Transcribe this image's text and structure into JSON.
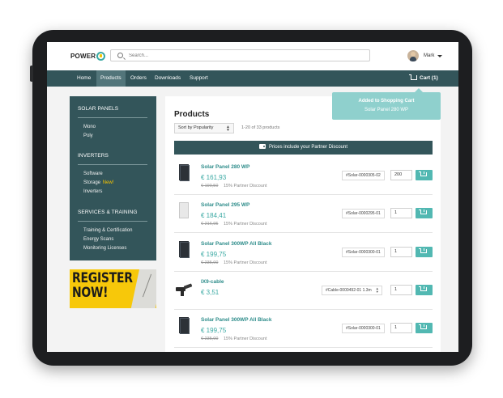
{
  "brand": {
    "logo_text": "POWER",
    "accent": "#3aa9a3",
    "nav_color": "#33555a"
  },
  "search": {
    "placeholder": "Search..."
  },
  "user": {
    "name": "Mark"
  },
  "nav": {
    "items": [
      {
        "label": "Home"
      },
      {
        "label": "Products",
        "active": true
      },
      {
        "label": "Orders"
      },
      {
        "label": "Downloads"
      },
      {
        "label": "Support"
      }
    ],
    "cart_label": "Cart (1)"
  },
  "toast": {
    "title": "Added to Shopping Cart",
    "subtitle": "Solar Panel 280 WP"
  },
  "sidebar": {
    "sections": [
      {
        "title": "SOLAR PANELS",
        "items": [
          {
            "label": "Mono"
          },
          {
            "label": "Poly"
          }
        ]
      },
      {
        "title": "INVERTERS",
        "items": [
          {
            "label": "Software"
          },
          {
            "label": "Storage",
            "badge": "New!"
          },
          {
            "label": "Inverters"
          }
        ]
      },
      {
        "title": "SERVICES & TRAINING",
        "items": [
          {
            "label": "Training & Certification"
          },
          {
            "label": "Energy Scans"
          },
          {
            "label": "Monitoring Licenses"
          }
        ]
      }
    ]
  },
  "promo": {
    "line1": "REGISTER",
    "line2": "NOW!"
  },
  "main": {
    "title": "Products",
    "sort_label": "Sort by Popularity",
    "count": "1-20 of 33 products",
    "banner": "Prices include your Partner Discount"
  },
  "products": [
    {
      "name": "Solar Panel 280 WP",
      "price": "€ 161,93",
      "old_price": "€ 190,50",
      "discount": "15% Partner Discount",
      "sku": "#Solar-0000305-02",
      "qty": "200"
    },
    {
      "name": "Solar Panel 295 WP",
      "price": "€ 184,41",
      "old_price": "€ 216,95",
      "discount": "15% Partner Discount",
      "sku": "#Solar-0000295-01",
      "qty": "1"
    },
    {
      "name": "Solar Panel 300WP All Black",
      "price": "€ 199,75",
      "old_price": "€ 235,00",
      "discount": "15% Partner Discount",
      "sku": "#Solar-0000300-01",
      "qty": "1"
    },
    {
      "name": "IX9-cable",
      "price": "€ 3,51",
      "old_price": "",
      "discount": "",
      "sku": "#Cable-0000492-01 1.3m",
      "qty": "1"
    },
    {
      "name": "Solar Panel 300WP All Black",
      "price": "€ 199,75",
      "old_price": "€ 235,00",
      "discount": "15% Partner Discount",
      "sku": "#Solar-0000300-01",
      "qty": "1"
    }
  ]
}
